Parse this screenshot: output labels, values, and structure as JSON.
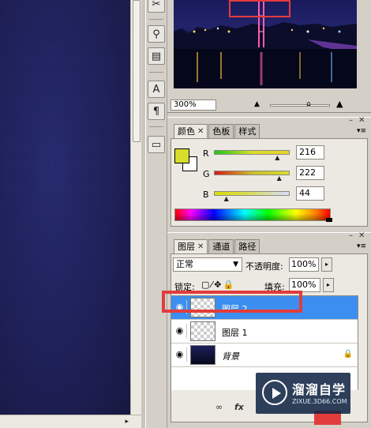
{
  "navigator": {
    "zoom": "300%"
  },
  "color_panel": {
    "tabs": [
      "颜色",
      "色板",
      "样式"
    ],
    "foreground_color": "#d8de2c",
    "background_color": "#ffffff",
    "channels": [
      {
        "label": "R",
        "value": "216",
        "fraction": 0.847,
        "gradient": [
          "#18c818",
          "#d8de2c",
          "#e8d22c"
        ]
      },
      {
        "label": "G",
        "value": "222",
        "fraction": 0.871,
        "gradient": [
          "#d81818",
          "#c8be2c",
          "#d8de2c"
        ]
      },
      {
        "label": "B",
        "value": "44",
        "fraction": 0.173,
        "gradient": [
          "#d8de00",
          "#d8de60",
          "#d8deff"
        ]
      }
    ]
  },
  "layers_panel": {
    "tabs": [
      "图层",
      "通道",
      "路径"
    ],
    "blend_mode": "正常",
    "opacity_label": "不透明度:",
    "opacity_value": "100%",
    "lock_label": "锁定:",
    "fill_label": "填充:",
    "fill_value": "100%",
    "layers": [
      {
        "name": "图层 2",
        "selected": true,
        "thumb": "transparent",
        "locked": false,
        "italic": false
      },
      {
        "name": "图层 1",
        "selected": false,
        "thumb": "transparent",
        "locked": false,
        "italic": false
      },
      {
        "name": "背景",
        "selected": false,
        "thumb": "photo",
        "locked": true,
        "italic": true
      }
    ],
    "footer_icons": [
      "link-icon",
      "fx-icon"
    ]
  },
  "watermark": {
    "title": "溜溜自学",
    "url": "ZIXUE.3D66.COM"
  },
  "colors": {
    "selection": "#3c8ff0",
    "annotation_red": "#e23c3c"
  }
}
